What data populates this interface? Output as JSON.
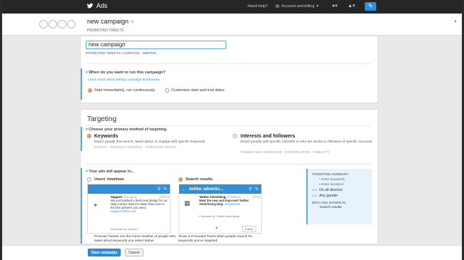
{
  "topbar": {
    "brand": "Ads",
    "help": "Need help?",
    "account": "Account and billing",
    "user_icon": "user-icon",
    "bell_icon": "bell-icon",
    "compose_icon": "compose-icon"
  },
  "header": {
    "campaign_name": "new campaign",
    "campaign_type": "PROMOTED TWEETS"
  },
  "name_section": {
    "input_value": "new campaign",
    "sub_text": "PROMOTED TWEETS CAMPAIGN -",
    "switch_label": "SWITCH"
  },
  "schedule": {
    "question": "When do you want to run this campaign?",
    "learn_more": "Learn more about setting campaign timeframes.",
    "option_1": "Start immediately, run continuously",
    "option_2": "Customize start and end dates"
  },
  "targeting": {
    "title": "Targeting",
    "question": "Choose your primary method of targeting.",
    "keywords_title": "Keywords",
    "keywords_desc": "Reach people that search, tweet about, or engage with specific keywords",
    "keywords_tags": "EVENTS · PRODUCT INTEREST · PURCHASE INTENT",
    "interests_title": "Interests and followers",
    "interests_desc": "Reach people with specific interests or who are similar to followers of specific accounts",
    "interests_tags": "FINDING NEW AUDIENCES · CONVERSATION · PUBLICITY"
  },
  "placement": {
    "question": "Your ads will appear in...",
    "timelines_label": "Users' timelines",
    "timelines_tweet_name": "Support",
    "timelines_tweet_handle": "@Support",
    "timelines_tweet_date": "4/20/13",
    "timelines_tweet_text": "We just hatched a fresh new design for our Help Center! Now it's easier than ever to find the answers you need.",
    "timelines_tweet_link": "support.twitter.com",
    "timelines_promoted": "Promoted by Support",
    "timelines_desc": "Promote Tweets into the home timeline of people who tweet about keywords you select below",
    "search_label": "Search results",
    "search_bar_title": "twitter advertis...",
    "search_tweet_name": "Twitter Advertising",
    "search_tweet_handle": "@TwitterA...",
    "search_tweet_date": "4/7/13",
    "search_tweet_text": "Meet the new and improved Twitter Advertising blog:",
    "search_tweet_link": "ow.ly/fZZZK",
    "search_promoted": "Promoted by Twitter Advertising",
    "search_follow": "Follow",
    "search_desc": "Show a Promoted Tweet when people search for keywords you've targeted"
  },
  "summary": {
    "title": "TARGETING SUMMARY",
    "item_1": "Enter keywords",
    "item_2": "Enter locations",
    "and_1": "AND",
    "devices": "On all devices",
    "and_2": "AND",
    "gender": "Any gender",
    "ads_shown": "WITH ADS SHOWN IN",
    "placement": "Search results"
  },
  "footer": {
    "save": "Save campaign",
    "cancel": "Cancel"
  },
  "colors": {
    "accent": "#2f8fd8",
    "radio_selected": "#e06a1f",
    "topbar": "#262626"
  }
}
